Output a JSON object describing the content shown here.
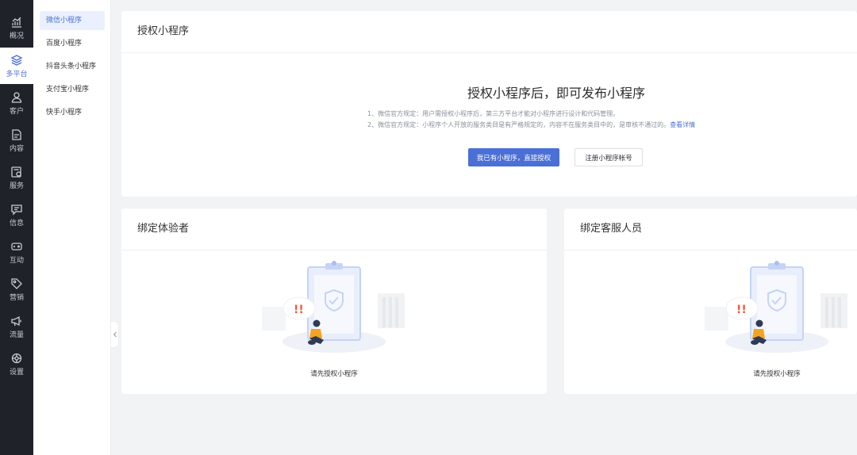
{
  "rail": {
    "items": [
      {
        "label": "概况",
        "icon": "chart-icon"
      },
      {
        "label": "多平台",
        "icon": "layers-icon",
        "active": true
      },
      {
        "label": "客户",
        "icon": "user-icon"
      },
      {
        "label": "内容",
        "icon": "document-icon"
      },
      {
        "label": "服务",
        "icon": "service-icon"
      },
      {
        "label": "信息",
        "icon": "message-icon"
      },
      {
        "label": "互动",
        "icon": "gamepad-icon"
      },
      {
        "label": "营销",
        "icon": "tag-icon"
      },
      {
        "label": "流量",
        "icon": "megaphone-icon"
      },
      {
        "label": "设置",
        "icon": "settings-icon"
      }
    ]
  },
  "submenu": {
    "items": [
      {
        "label": "微信小程序",
        "active": true
      },
      {
        "label": "百度小程序"
      },
      {
        "label": "抖音头条小程序"
      },
      {
        "label": "支付宝小程序"
      },
      {
        "label": "快手小程序"
      }
    ]
  },
  "auth_card": {
    "title": "授权小程序",
    "headline": "授权小程序后，即可发布小程序",
    "rule1": "1、微信官方规定：用户需授权小程序后，第三方平台才能对小程序进行设计和代码管理。",
    "rule2": "2、微信官方规定：小程序个人开放的服务类目是有严格规定的，内容不在服务类目中的，是审核不通过的。",
    "rule2_link": "查看详情",
    "primary_button": "我已有小程序，直接授权",
    "secondary_button": "注册小程序帐号"
  },
  "tester_card": {
    "title": "绑定体验者",
    "empty_text": "请先授权小程序"
  },
  "cs_card": {
    "title": "绑定客服人员",
    "empty_text": "请先授权小程序"
  },
  "colors": {
    "accent": "#4a6fd6",
    "rail_bg": "#1f2229",
    "page_bg": "#f2f3f5"
  }
}
